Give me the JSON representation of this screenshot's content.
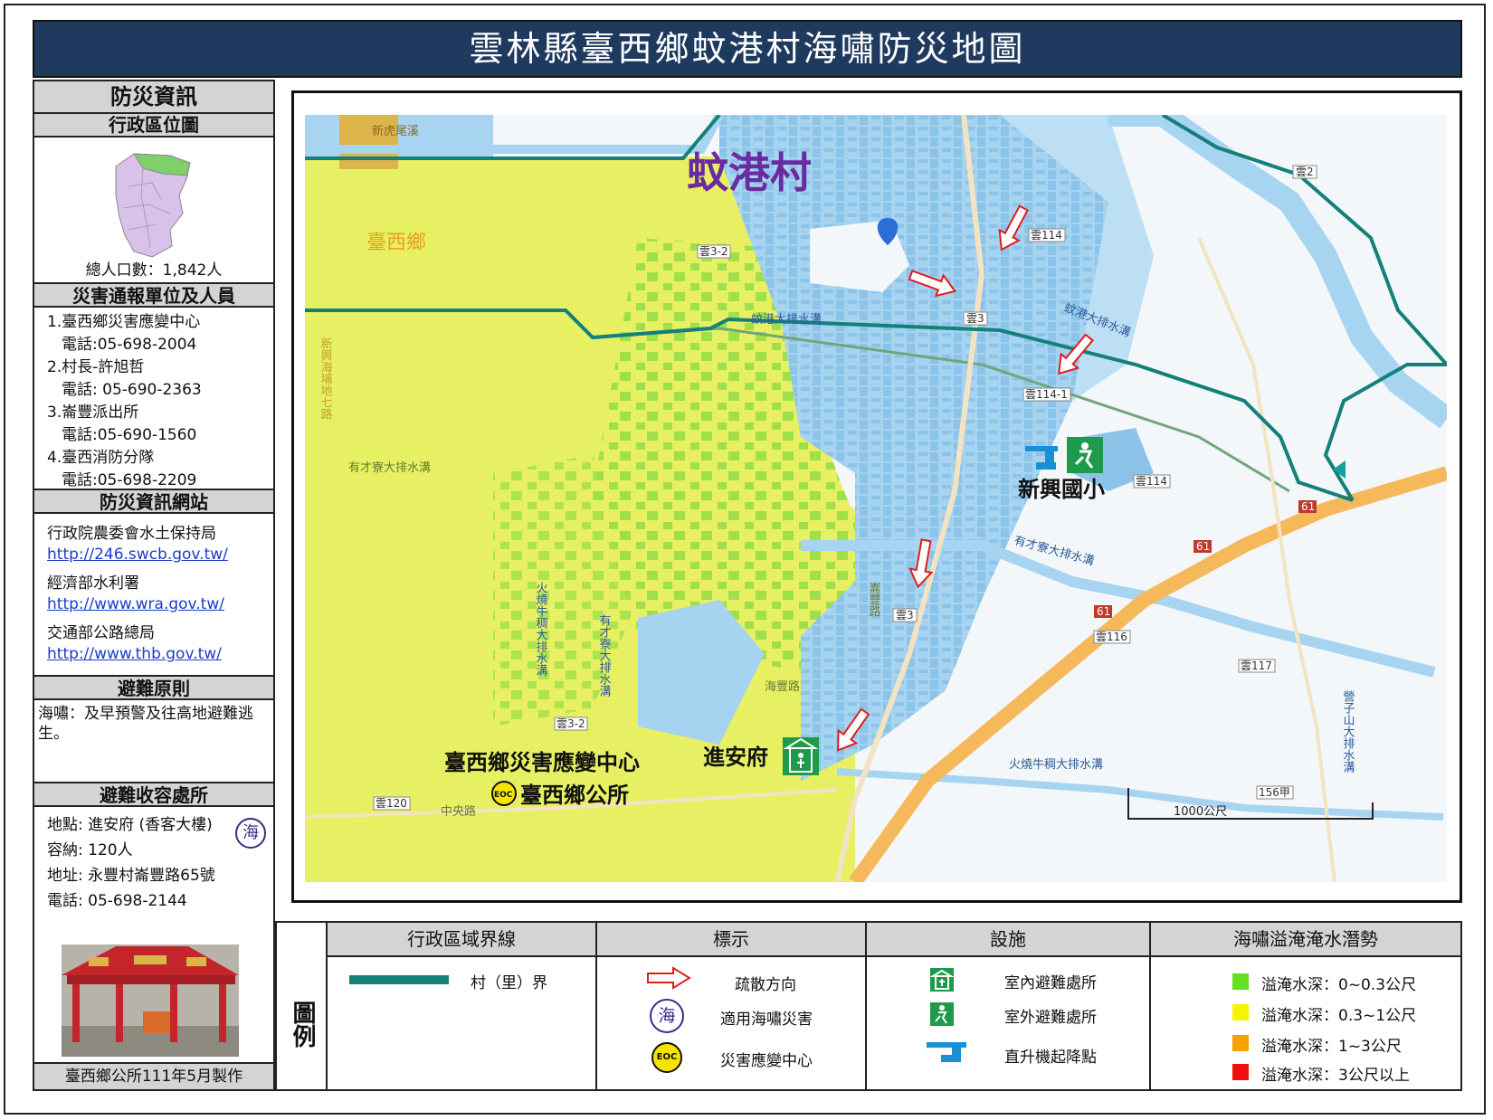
{
  "title": "雲林縣臺西鄉蚊港村海嘯防災地圖",
  "sidebar": {
    "info_header": "防災資訊",
    "admin_map_header": "行政區位圖",
    "population": "總人口數：1,842人",
    "contacts_header": "災害通報單位及人員",
    "contacts": [
      {
        "name": "1.臺西鄉災害應變中心",
        "phone": "電話:05-698-2004"
      },
      {
        "name": "2.村長-許旭哲",
        "phone": "電話: 05-690-2363"
      },
      {
        "name": "3.崙豐派出所",
        "phone": "電話:05-690-1560"
      },
      {
        "name": "4.臺西消防分隊",
        "phone": "電話:05-698-2209"
      }
    ],
    "websites_header": "防災資訊網站",
    "websites": [
      {
        "org": "行政院農委會水土保持局",
        "url": "http://246.swcb.gov.tw/"
      },
      {
        "org": "經濟部水利署",
        "url": "http://www.wra.gov.tw/"
      },
      {
        "org": "交通部公路總局",
        "url": "http://www.thb.gov.tw/"
      }
    ],
    "principle_header": "避難原則",
    "principle_text": "海嘯：及早預警及往高地避難逃生。",
    "shelter_header": "避難收容處所",
    "shelter": {
      "location": "地點: 進安府 (香客大樓)",
      "capacity": "容納: 120人",
      "address": "地址: 永豐村崙豐路65號",
      "phone": "電話: 05-698-2144",
      "badge": "海"
    },
    "footer": "臺西鄉公所111年5月製作"
  },
  "map": {
    "village_label": "蚊港村",
    "township_label": "臺西鄉",
    "school_label": "新興國小",
    "temple_label": "進安府",
    "eoc_label": "臺西鄉災害應變中心",
    "office_label": "臺西鄉公所",
    "eoc_badge": "EOC",
    "scale_label": "1000公尺",
    "place_labels": [
      "新虎尾溪",
      "蚊港大排水溝",
      "蚊港大排水溝",
      "有才寮大排水溝",
      "有才寮大排水溝",
      "火燒牛稠大排水溝",
      "火燒牛稠大排水溝",
      "新興海埔地七路",
      "有才寮大排水溝",
      "中央路",
      "崙豐路",
      "海豐路",
      "營子山大排水溝"
    ],
    "road_labels": [
      "雲2",
      "雲114",
      "雲3-2",
      "雲3",
      "雲114-1",
      "雲114",
      "61",
      "61",
      "61",
      "雲3",
      "雲116",
      "雲117",
      "雲3-2",
      "雲120",
      "156甲"
    ]
  },
  "legend": {
    "side_label": "圖例",
    "boundary_header": "行政區域界線",
    "boundary_item": "村（里）界",
    "boundary_color": "#14807a",
    "marks_header": "標示",
    "marks": [
      "疏散方向",
      "適用海嘯災害",
      "災害應變中心"
    ],
    "marks_badge_sea": "海",
    "marks_badge_eoc": "EOC",
    "facilities_header": "設施",
    "facilities": [
      "室內避難處所",
      "室外避難處所",
      "直升機起降點"
    ],
    "inundation_header": "海嘯溢淹淹水潛勢",
    "inundation": [
      {
        "label": "溢淹水深：0~0.3公尺",
        "color": "#66e01e"
      },
      {
        "label": "溢淹水深：0.3~1公尺",
        "color": "#f5f500"
      },
      {
        "label": "溢淹水深：1~3公尺",
        "color": "#f5a300"
      },
      {
        "label": "溢淹水深：3公尺以上",
        "color": "#ee1010"
      }
    ]
  },
  "colors": {
    "title_bg": "#1f3a5f",
    "flood_blue": "#a5d3f0",
    "flood_yellow": "#e6f062",
    "flood_green": "#9fe04a",
    "river": "#a7d4f0",
    "village_boundary": "#14807a",
    "highway": "#f5b85a",
    "arrow": "#e21b1b"
  }
}
